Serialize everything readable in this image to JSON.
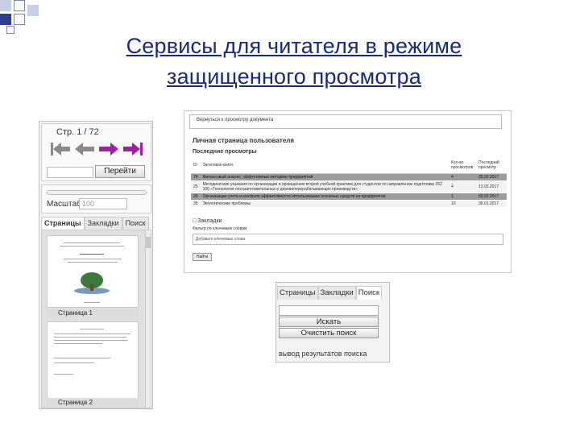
{
  "slide": {
    "title_line1": "Сервисы для читателя в режиме",
    "title_line2": "защищенного просмотра"
  },
  "viewer": {
    "page_label": "Стр. 1 / 72",
    "go_button": "Перейти",
    "zoom_label": "Масштаб:",
    "zoom_value": "100",
    "tabs": [
      "Страницы",
      "Закладки",
      "Поиск"
    ],
    "thumbnails": [
      {
        "caption": "Страница 1"
      },
      {
        "caption": "Страница 2"
      }
    ],
    "colors": {
      "nav_back": "#8a8a8a",
      "nav_forward": "#a020a0"
    }
  },
  "cabinet": {
    "breadcrumb": "Вернуться к просмотру документа",
    "title": "Личная страница пользователя",
    "subtitle": "Последние просмотры",
    "headers": [
      "ID",
      "Заголовок книги",
      "Кол-во просмотров",
      "Последний просмотр"
    ],
    "rows": [
      {
        "id": "74",
        "title": "Финансовый анализ: эффективные методики предприятий",
        "count": "4",
        "date": "25.02.2017",
        "style": "dark"
      },
      {
        "id": "25",
        "title": "Методические указания по организации и проведению второй учебной практики для студентов по направлению подготовки 252 100 «Технология лесозаготовительных и деревоперерабатывающих производств»",
        "count": "4",
        "date": "13.02.2017",
        "style": "light"
      },
      {
        "id": "26",
        "title": "Организация учета и контроля эффективности использования основных средств на предприятии",
        "count": "1",
        "date": "03.02.2017",
        "style": "dark"
      },
      {
        "id": "35",
        "title": "Экологические проблемы",
        "count": "10",
        "date": "30.01.2017",
        "style": "light"
      }
    ],
    "bookmarks_title": "□ Закладки",
    "bookmarks_filter": "Фильтр по ключевым словам",
    "bookmarks_placeholder": "Добавьте ключевые слова",
    "bookmarks_button": "Найти"
  },
  "search": {
    "tabs": [
      "Страницы",
      "Закладки",
      "Поиск"
    ],
    "search_button": "Искать",
    "clear_button": "Очистить поиск",
    "output_label": "вывод результатов поиска"
  }
}
